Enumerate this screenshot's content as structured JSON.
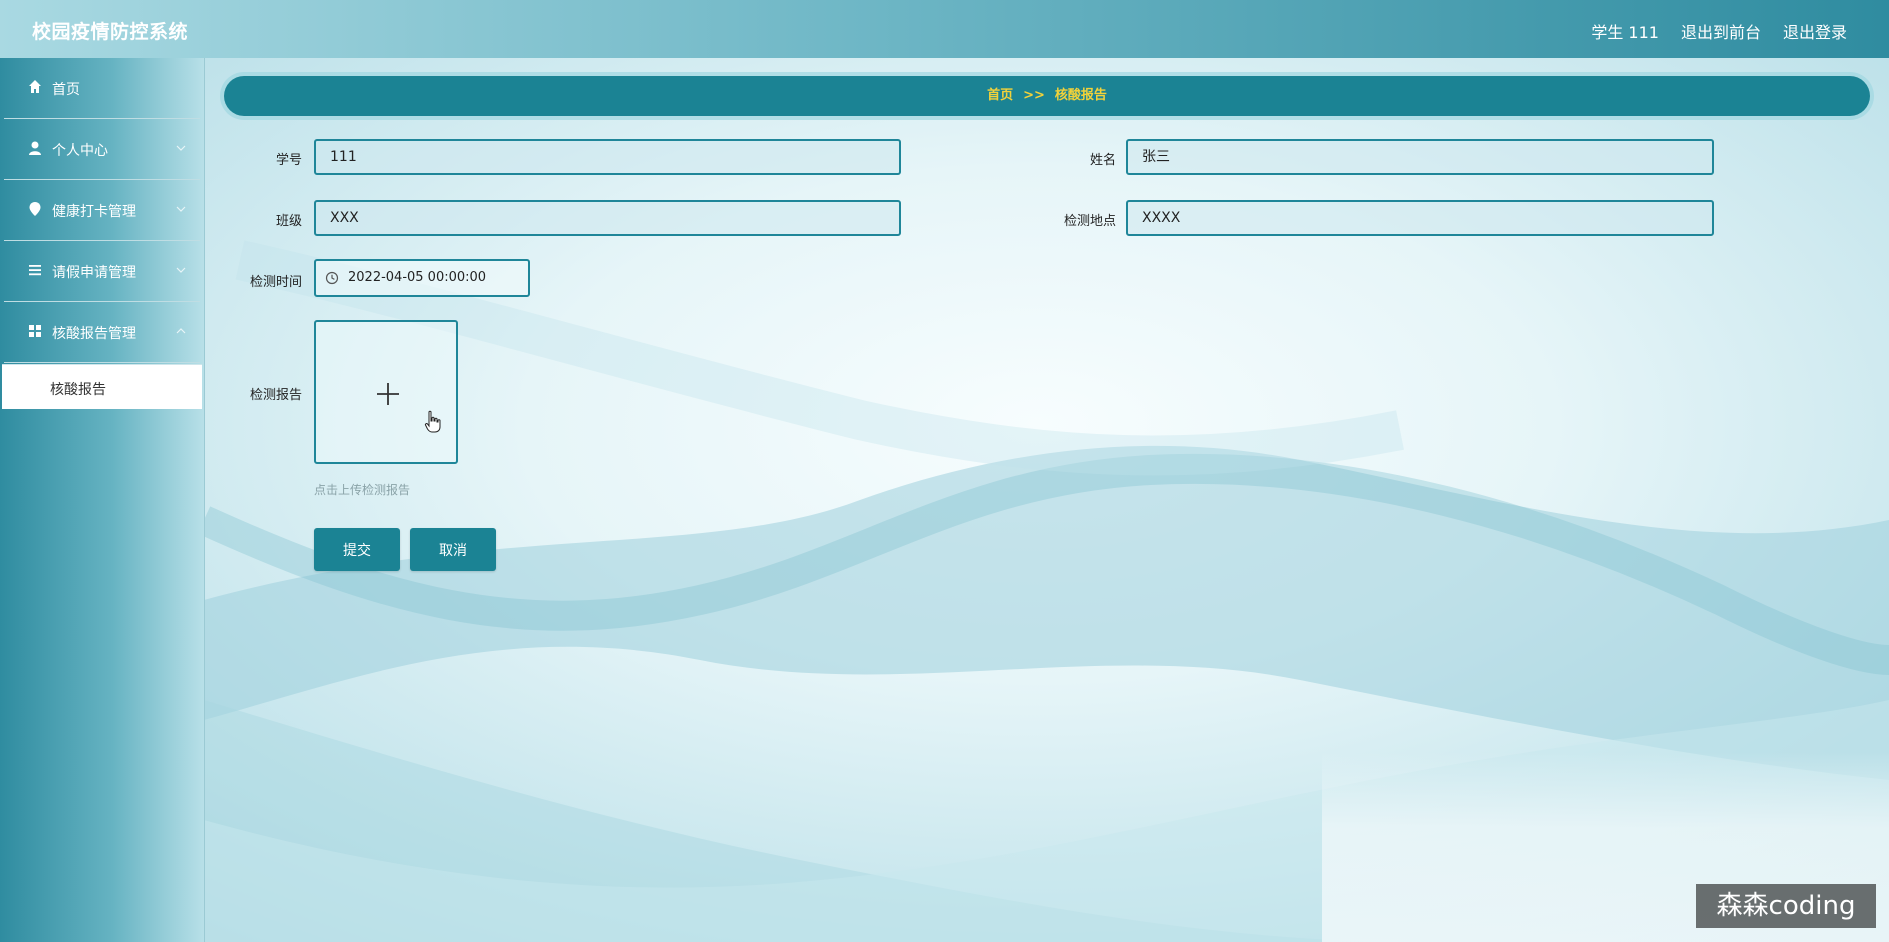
{
  "header": {
    "title": "校园疫情防控系统",
    "user": "学生 111",
    "to_front": "退出到前台",
    "logout": "退出登录"
  },
  "sidebar": {
    "items": [
      {
        "label": "首页",
        "icon": "home-icon"
      },
      {
        "label": "个人中心",
        "icon": "user-icon"
      },
      {
        "label": "健康打卡管理",
        "icon": "location-icon"
      },
      {
        "label": "请假申请管理",
        "icon": "list-icon"
      },
      {
        "label": "核酸报告管理",
        "icon": "grid-icon"
      }
    ],
    "active_sub": "核酸报告"
  },
  "breadcrumb": {
    "home": "首页",
    "separator": ">>",
    "current": "核酸报告"
  },
  "form": {
    "student_id_label": "学号",
    "student_id_value": "111",
    "name_label": "姓名",
    "name_value": "张三",
    "class_label": "班级",
    "class_value": "XXX",
    "location_label": "检测地点",
    "location_value": "XXXX",
    "time_label": "检测时间",
    "time_value": "2022-04-05 00:00:00",
    "report_label": "检测报告",
    "upload_tip": "点击上传检测报告",
    "submit": "提交",
    "cancel": "取消"
  },
  "watermark": "森森coding",
  "colors": {
    "accent": "#1b8394",
    "breadcrumb_text": "#f2d23a",
    "border": "#1f8699"
  }
}
